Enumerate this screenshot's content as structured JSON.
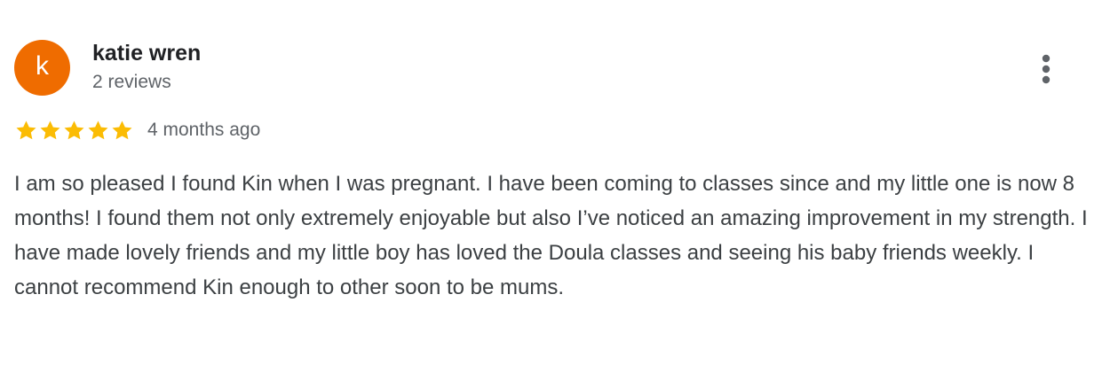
{
  "review": {
    "author": {
      "initial": "k",
      "name": "katie wren",
      "reviews_count": "2 reviews",
      "avatar_color": "#ef6c00"
    },
    "rating": 5,
    "rating_max": 5,
    "star_color": "#fbbc04",
    "date": "4 months ago",
    "text": "I am so pleased I found Kin when I was pregnant. I have been coming to classes since and my little one is now 8 months! I found them not only extremely enjoyable but also I’ve noticed an amazing improvement in my strength. I have made lovely friends and my little boy has loved the Doula classes and seeing his baby friends weekly. I cannot recommend Kin enough to other soon to be mums.",
    "more_icon": "more-vert-icon"
  }
}
